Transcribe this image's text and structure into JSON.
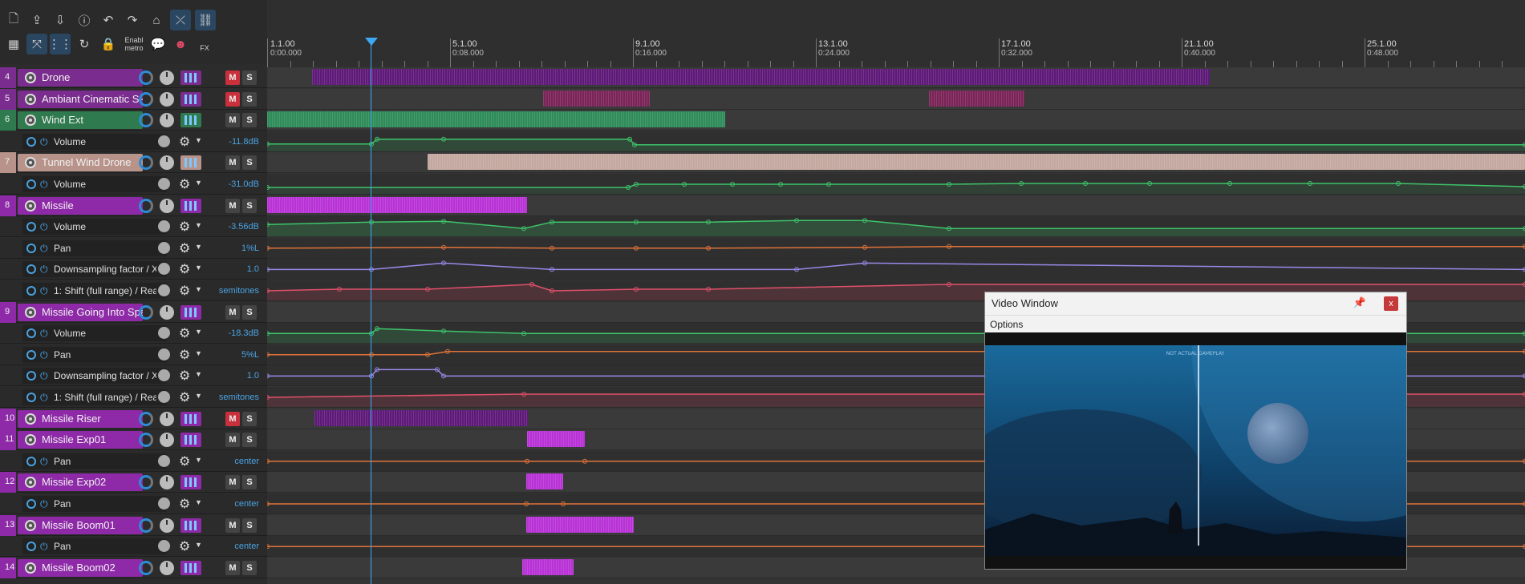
{
  "toolbar": {
    "enable_metro_label": "Enabl\nmetro",
    "fx_label": "FX"
  },
  "ruler": {
    "marks": [
      {
        "bar": "1.1.00",
        "time": "0:00.000"
      },
      {
        "bar": "5.1.00",
        "time": "0:08.000"
      },
      {
        "bar": "9.1.00",
        "time": "0:16.000"
      },
      {
        "bar": "13.1.00",
        "time": "0:24.000"
      },
      {
        "bar": "17.1.00",
        "time": "0:32.000"
      },
      {
        "bar": "21.1.00",
        "time": "0:40.000"
      },
      {
        "bar": "25.1.00",
        "time": "0:48.000"
      }
    ]
  },
  "tracks": [
    {
      "num": "4",
      "name": "Drone",
      "color": "#7a2d8e",
      "m": "M",
      "s": "S",
      "m_on": true
    },
    {
      "num": "5",
      "name": "Ambiant Cinematic SF",
      "color": "#7a2d8e",
      "m": "M",
      "s": "S",
      "m_on": true
    },
    {
      "num": "6",
      "name": "Wind Ext",
      "color": "#2f7a4e",
      "m": "M",
      "s": "S"
    },
    {
      "env": true,
      "label": "Volume",
      "value": "-11.8dB"
    },
    {
      "num": "7",
      "name": "Tunnel Wind Drone",
      "color": "#b8938a",
      "m": "M",
      "s": "S"
    },
    {
      "env": true,
      "label": "Volume",
      "value": "-31.0dB"
    },
    {
      "num": "8",
      "name": "Missile",
      "color": "#8e2aa8",
      "m": "M",
      "s": "S"
    },
    {
      "env": true,
      "label": "Volume",
      "value": "-3.56dB"
    },
    {
      "env": true,
      "label": "Pan",
      "value": "1%L"
    },
    {
      "env": true,
      "label": "Downsampling factor / X",
      "value": "1.0"
    },
    {
      "env": true,
      "label": "1: Shift (full range) / Rea",
      "value": "semitones"
    },
    {
      "num": "9",
      "name": "Missile Going Into Space",
      "color": "#8e2aa8",
      "m": "M",
      "s": "S"
    },
    {
      "env": true,
      "label": "Volume",
      "value": "-18.3dB"
    },
    {
      "env": true,
      "label": "Pan",
      "value": "5%L"
    },
    {
      "env": true,
      "label": "Downsampling factor / X",
      "value": "1.0"
    },
    {
      "env": true,
      "label": "1: Shift (full range) / Rea",
      "value": "semitones"
    },
    {
      "num": "10",
      "name": "Missile Riser",
      "color": "#8e2aa8",
      "m": "M",
      "s": "S",
      "m_on": true
    },
    {
      "num": "11",
      "name": "Missile Exp01",
      "color": "#8e2aa8",
      "m": "M",
      "s": "S"
    },
    {
      "env": true,
      "label": "Pan",
      "value": "center"
    },
    {
      "num": "12",
      "name": "Missile Exp02",
      "color": "#8e2aa8",
      "m": "M",
      "s": "S"
    },
    {
      "env": true,
      "label": "Pan",
      "value": "center"
    },
    {
      "num": "13",
      "name": "Missile Boom01",
      "color": "#8e2aa8",
      "m": "M",
      "s": "S"
    },
    {
      "env": true,
      "label": "Pan",
      "value": "center"
    },
    {
      "num": "14",
      "name": "Missile Boom02",
      "color": "#8e2aa8",
      "m": "M",
      "s": "S"
    }
  ],
  "video": {
    "title": "Video Window",
    "menu": "Options",
    "close": "x",
    "overlay_top": "NOT ACTUAL GAMEPLAY"
  }
}
